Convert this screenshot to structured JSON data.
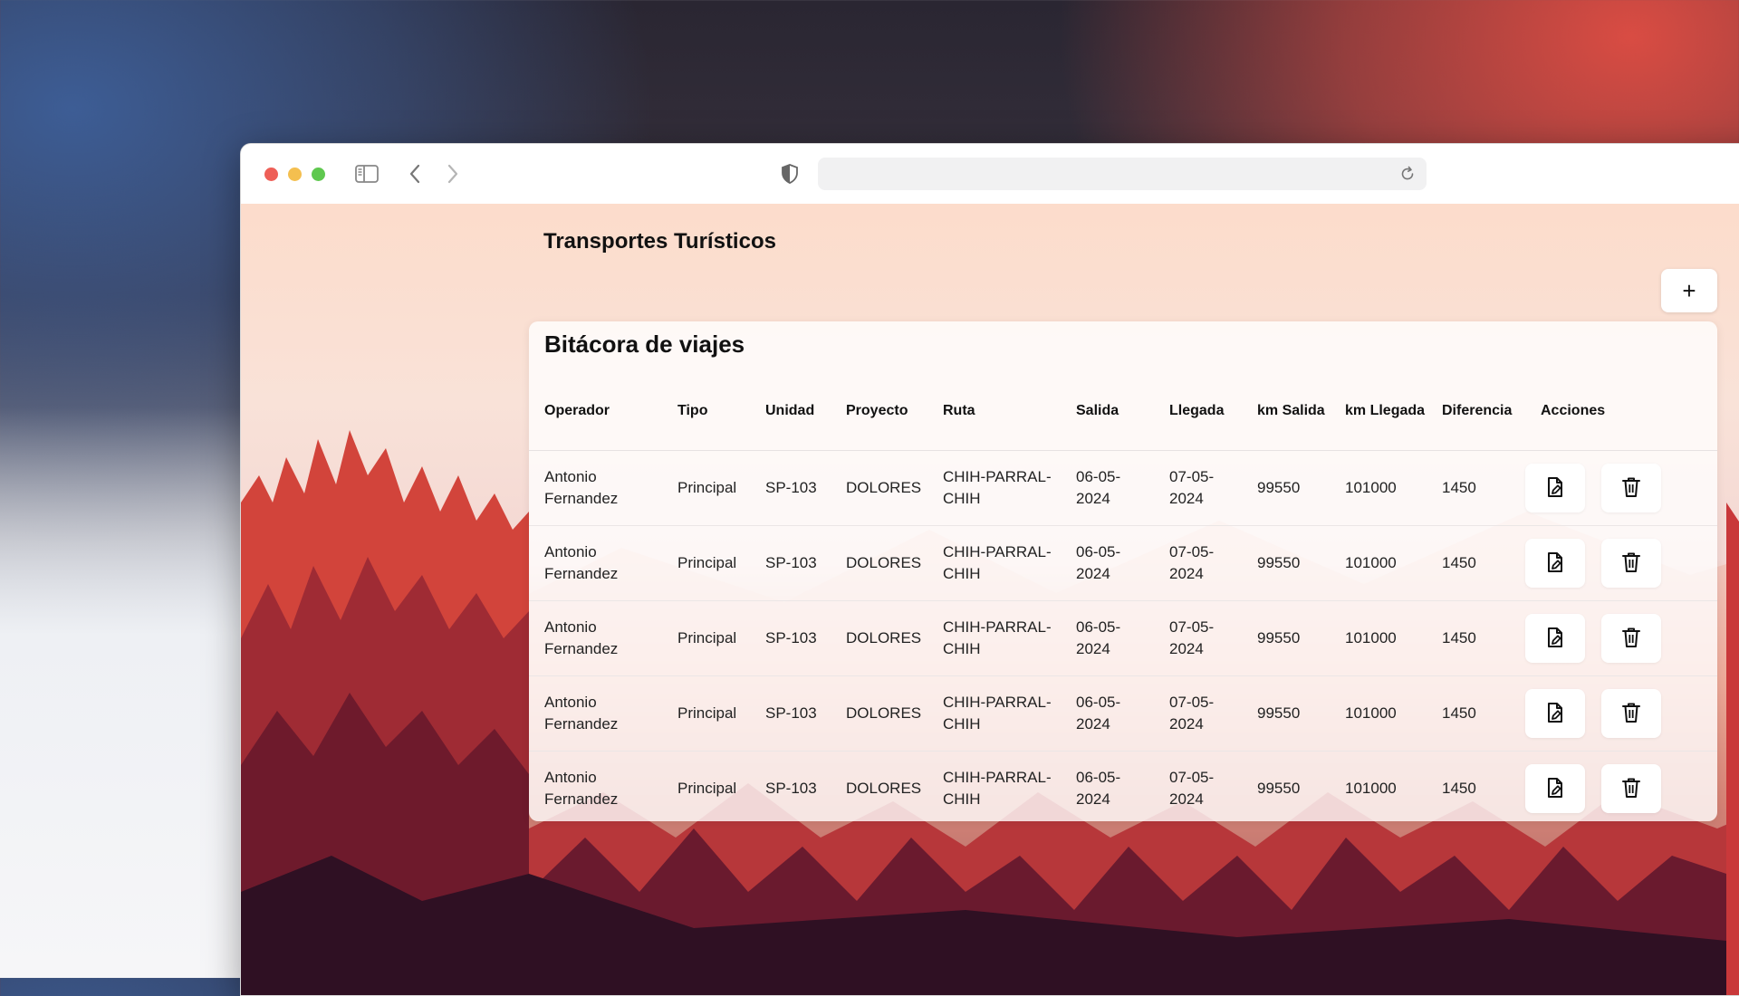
{
  "app": {
    "title": "Transportes Turísticos",
    "add_label": "+"
  },
  "browser": {
    "url": ""
  },
  "table": {
    "title": "Bitácora de viajes",
    "headers": [
      "Operador",
      "Tipo",
      "Unidad",
      "Proyecto",
      "Ruta",
      "Salida",
      "Llegada",
      "km Salida",
      "km Llegada",
      "Diferencia",
      "Acciones"
    ],
    "rows": [
      {
        "operador": "Antonio Fernandez",
        "tipo": "Principal",
        "unidad": "SP-103",
        "proyecto": "DOLORES",
        "ruta": "CHIH-PARRAL-CHIH",
        "salida": "06-05-2024",
        "llegada": "07-05-2024",
        "km_salida": "99550",
        "km_llegada": "101000",
        "diferencia": "1450"
      },
      {
        "operador": "Antonio Fernandez",
        "tipo": "Principal",
        "unidad": "SP-103",
        "proyecto": "DOLORES",
        "ruta": "CHIH-PARRAL-CHIH",
        "salida": "06-05-2024",
        "llegada": "07-05-2024",
        "km_salida": "99550",
        "km_llegada": "101000",
        "diferencia": "1450"
      },
      {
        "operador": "Antonio Fernandez",
        "tipo": "Principal",
        "unidad": "SP-103",
        "proyecto": "DOLORES",
        "ruta": "CHIH-PARRAL-CHIH",
        "salida": "06-05-2024",
        "llegada": "07-05-2024",
        "km_salida": "99550",
        "km_llegada": "101000",
        "diferencia": "1450"
      },
      {
        "operador": "Antonio Fernandez",
        "tipo": "Principal",
        "unidad": "SP-103",
        "proyecto": "DOLORES",
        "ruta": "CHIH-PARRAL-CHIH",
        "salida": "06-05-2024",
        "llegada": "07-05-2024",
        "km_salida": "99550",
        "km_llegada": "101000",
        "diferencia": "1450"
      },
      {
        "operador": "Antonio Fernandez",
        "tipo": "Principal",
        "unidad": "SP-103",
        "proyecto": "DOLORES",
        "ruta": "CHIH-PARRAL-CHIH",
        "salida": "06-05-2024",
        "llegada": "07-05-2024",
        "km_salida": "99550",
        "km_llegada": "101000",
        "diferencia": "1450"
      }
    ],
    "row_actions": [
      "edit-document-icon",
      "trash-icon"
    ]
  },
  "colors": {
    "close": "#ee5f57",
    "minimize": "#f4bf4f",
    "maximize": "#5fc84f"
  }
}
